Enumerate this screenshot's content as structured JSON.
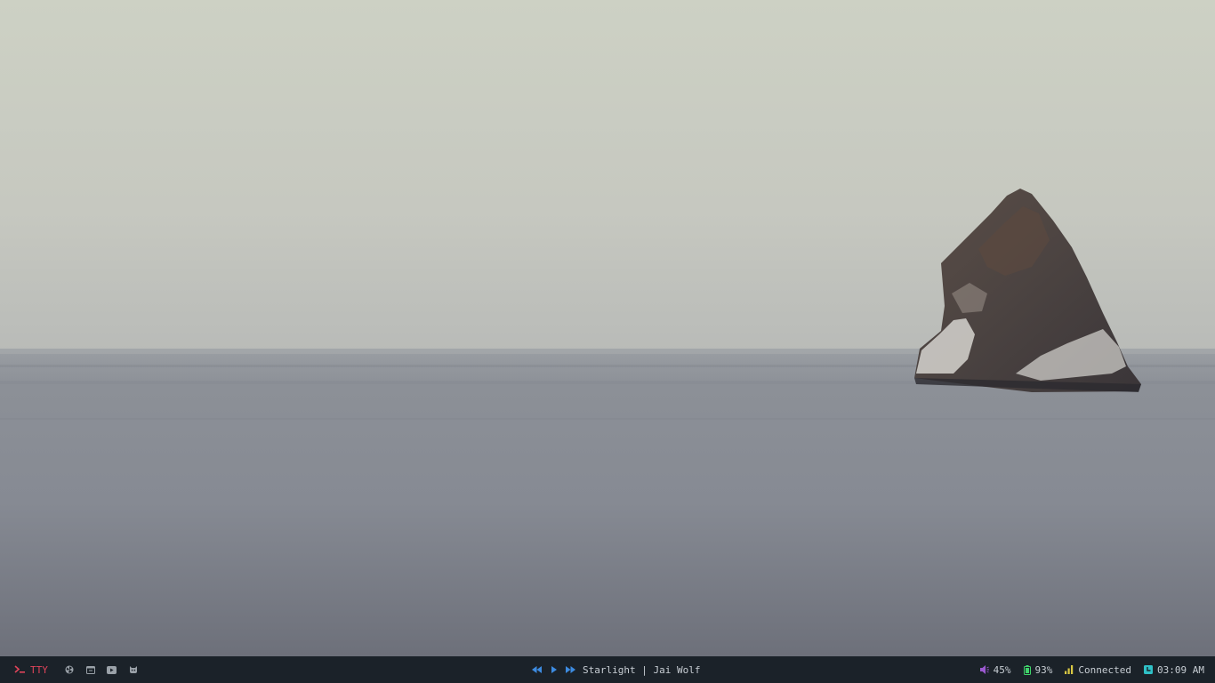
{
  "desktop": {
    "wallpaper_icon": "sea-stack-photo"
  },
  "taskbar": {
    "launcher": {
      "icon": "terminal-prompt-icon",
      "label": "TTY",
      "color": "#e0445a"
    },
    "workspaces": [
      {
        "icon": "fan-icon"
      },
      {
        "icon": "window-icon"
      },
      {
        "icon": "youtube-icon"
      },
      {
        "icon": "cat-icon"
      }
    ],
    "media": {
      "controls": [
        {
          "icon": "previous-icon"
        },
        {
          "icon": "play-icon"
        },
        {
          "icon": "next-icon"
        }
      ],
      "now_playing": "Starlight | Jai Wolf",
      "accent": "#3d8be0"
    },
    "status": {
      "volume": {
        "icon": "speaker-icon",
        "value": "45%",
        "color": "#9b59d0"
      },
      "battery": {
        "icon": "battery-icon",
        "value": "93%",
        "color": "#3fd26a"
      },
      "network": {
        "icon": "signal-bars-icon",
        "value": "Connected",
        "color": "#d9c843"
      },
      "clock": {
        "icon": "clock-icon",
        "value": "03:09 AM",
        "color": "#2fc0c6"
      }
    }
  }
}
